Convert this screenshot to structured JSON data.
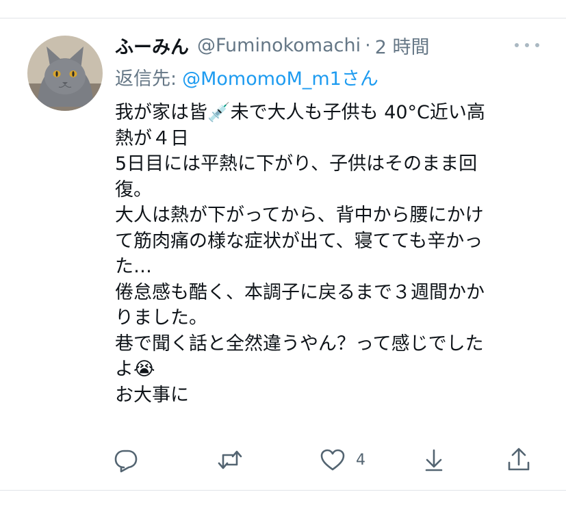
{
  "tweet": {
    "display_name": "ふーみん",
    "handle": "@Fuminokomachi",
    "separator": "·",
    "time": "2 時間",
    "reply_prefix": "返信先:",
    "reply_to": "@MomomoM_m1",
    "reply_suffix": "さん",
    "lines": [
      "我が家は皆💉未で大人も子供も 40°C近い高",
      "熱が４日",
      "5日目には平熱に下がり、子供はそのまま回",
      "復。",
      "大人は熱が下がってから、背中から腰にかけ",
      "て筋肉痛の様な症状が出て、寝てても辛かっ",
      "た…",
      "倦怠感も酷く、本調子に戻るまで３週間かか",
      "りました。",
      "巷で聞く話と全然違うやん？って感じでした",
      "よ😭",
      "お大事に"
    ],
    "like_count": "4"
  },
  "icons": {
    "avatar": "gray-cat-avatar",
    "more": "more-dots-icon",
    "reply": "reply-icon",
    "retweet": "retweet-icon",
    "like": "heart-icon",
    "download": "download-icon",
    "share": "share-icon"
  },
  "colors": {
    "text": "#0f1419",
    "secondary": "#657786",
    "link": "#1d9bf0",
    "icon": "#536471",
    "divider": "#e1e4e8"
  }
}
